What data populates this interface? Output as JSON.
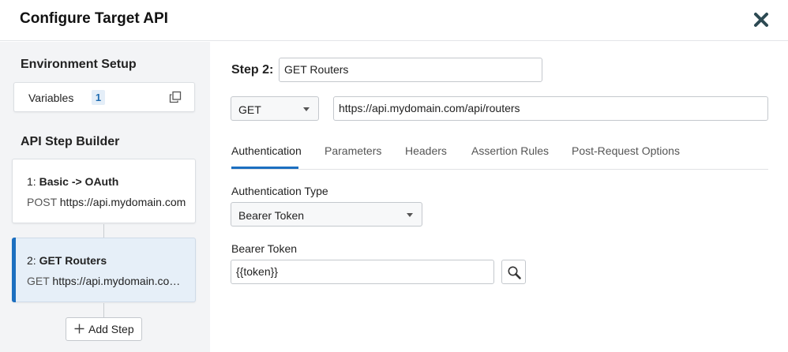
{
  "dialog": {
    "title": "Configure Target API"
  },
  "sidebar": {
    "environment_title": "Environment Setup",
    "variables": {
      "label": "Variables",
      "count": "1"
    },
    "builder_title": "API Step Builder",
    "steps": [
      {
        "number": "1:",
        "name": "Basic -> OAuth",
        "method": "POST",
        "url": "https://api.mydomain.com"
      },
      {
        "number": "2:",
        "name": "GET Routers",
        "method": "GET",
        "url": "https://api.mydomain.com/api/routers"
      }
    ],
    "add_step_label": "Add Step"
  },
  "main": {
    "step_label": "Step 2:",
    "step_name": "GET Routers",
    "method": "GET",
    "url": "https://api.mydomain.com/api/routers",
    "tabs": [
      {
        "label": "Authentication",
        "active": true
      },
      {
        "label": "Parameters",
        "active": false
      },
      {
        "label": "Headers",
        "active": false
      },
      {
        "label": "Assertion Rules",
        "active": false
      },
      {
        "label": "Post-Request Options",
        "active": false
      }
    ],
    "auth_type_label": "Authentication Type",
    "auth_type_value": "Bearer Token",
    "bearer_label": "Bearer Token",
    "bearer_value": "{{token}}"
  },
  "colors": {
    "accent": "#1c6fc0",
    "close_icon": "#2d4a53",
    "sidebar_bg": "#f3f4f6",
    "selected_step_bg": "#e6eff8"
  },
  "icons": {
    "close": "close-icon",
    "copy": "copy-icon",
    "plus": "plus-icon",
    "search": "search-icon",
    "caret": "caret-down-icon"
  }
}
